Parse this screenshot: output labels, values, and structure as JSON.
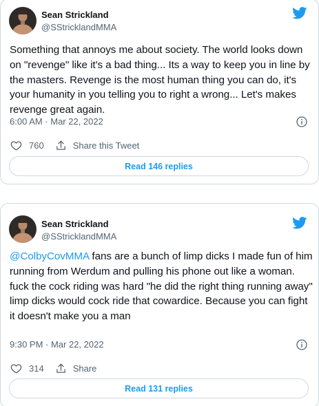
{
  "colors": {
    "accent": "#1d9bf0",
    "text": "#0f1419",
    "muted": "#536471",
    "border": "#cfd9de"
  },
  "tweets": [
    {
      "author": "Sean Strickland",
      "handle": "@SStricklandMMA",
      "text": "Something that annoys me about society. The world looks down on \"revenge\" like it's a bad thing... Its a way to keep you in line by the masters. Revenge is the most human thing you can do, it's your humanity in you telling you to right a wrong... Let's makes revenge great again.",
      "timestamp": "6:00 AM · Mar 22, 2022",
      "likes": "760",
      "share_label": "Share this Tweet",
      "read_replies": "Read 146 replies",
      "icons": [
        "avatar-photo",
        "twitter-bird-icon",
        "info-icon",
        "heart-icon",
        "share-icon"
      ]
    },
    {
      "author": "Sean Strickland",
      "handle": "@SStricklandMMA",
      "mention": "@ColbyCovMMA",
      "text": " fans are a bunch of limp dicks I made fun of him running from Werdum and pulling his phone out like a woman. fuck the cock riding was hard \"he did the right thing running away\" limp dicks would cock ride that cowardice. Because you can fight it doesn't make you a man",
      "timestamp": "9:30 PM · Mar 22, 2022",
      "likes": "314",
      "share_label": "Share",
      "read_replies": "Read 131 replies",
      "icons": [
        "avatar-photo",
        "twitter-bird-icon",
        "info-icon",
        "heart-icon",
        "share-icon"
      ]
    }
  ]
}
